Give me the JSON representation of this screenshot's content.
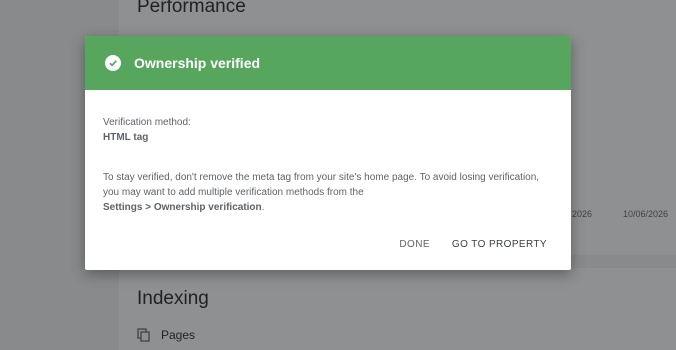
{
  "background": {
    "performance_title": "Performance",
    "x_ticks": [
      "2026",
      "10/06/2026"
    ],
    "indexing_title": "Indexing",
    "pages_label": "Pages"
  },
  "dialog": {
    "title": "Ownership verified",
    "method_label": "Verification method:",
    "method_value": "HTML tag",
    "message": "To stay verified, don't remove the meta tag from your site's home page. To avoid losing verification, you may want to add multiple verification methods from the",
    "message_link": "Settings > Ownership verification",
    "message_end": ".",
    "done_label": "DONE",
    "go_to_property_label": "GO TO PROPERTY"
  },
  "colors": {
    "header_green": "#57a65e",
    "chart_blue": "#4a6cc9"
  }
}
